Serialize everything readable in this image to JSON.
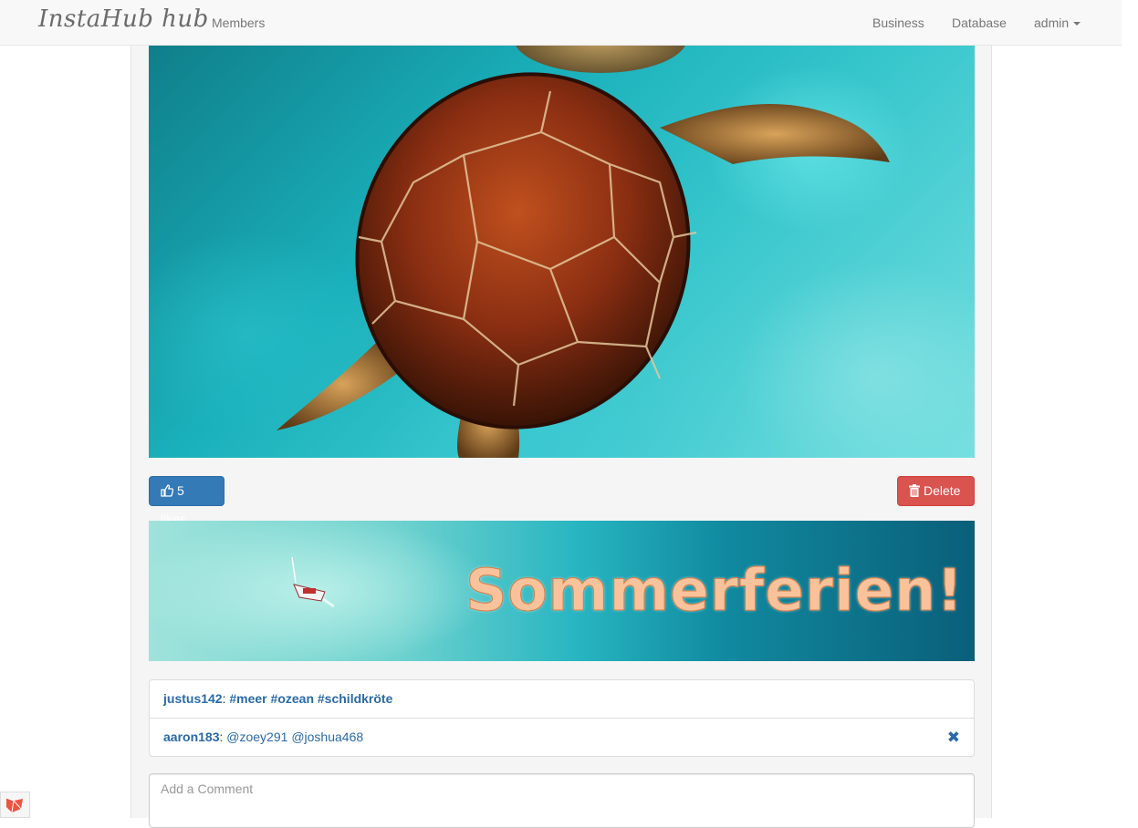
{
  "navbar": {
    "brand": "InstaHub hub",
    "left_links": [
      {
        "label": "Members"
      }
    ],
    "right_links": [
      {
        "label": "Business"
      },
      {
        "label": "Database"
      }
    ],
    "user_menu": {
      "label": "admin"
    }
  },
  "post": {
    "image_icon": "sea-turtle-photo",
    "likes_label": "5 likes",
    "like_icon": "thumbs-up-icon",
    "delete_label": "Delete",
    "delete_icon": "trash-icon"
  },
  "banner": {
    "text": "Sommerferien!",
    "icon": "sailboat-icon"
  },
  "comments": [
    {
      "user": "justus142",
      "separator": ":",
      "tags": [
        "#meer",
        "#ozean",
        "#schildkröte"
      ],
      "mentions": [],
      "removable": false
    },
    {
      "user": "aaron183",
      "separator": ":",
      "tags": [],
      "mentions": [
        "@zoey291",
        "@joshua468"
      ],
      "removable": true
    }
  ],
  "comment_form": {
    "placeholder": "Add a Comment",
    "value": ""
  },
  "colors": {
    "primary": "#337ab7",
    "danger": "#d9534f",
    "link": "#2a6aa8",
    "navbar_bg": "#f8f8f8"
  }
}
